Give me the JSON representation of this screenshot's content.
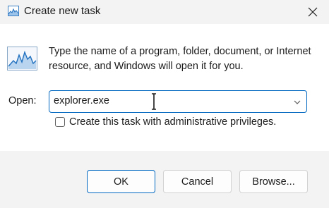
{
  "window": {
    "title": "Create new task",
    "app_icon": "task-manager-icon",
    "close_icon": "close-icon"
  },
  "content": {
    "description": "Type the name of a program, folder, document, or Internet resource, and Windows will open it for you.",
    "open_label": "Open:",
    "open_value": "explorer.exe",
    "admin_checkbox_label": "Create this task with administrative privileges.",
    "admin_checked": false
  },
  "buttons": {
    "ok": "OK",
    "cancel": "Cancel",
    "browse": "Browse..."
  },
  "colors": {
    "accent": "#0067c0",
    "chart_line": "#1f6fbf"
  }
}
